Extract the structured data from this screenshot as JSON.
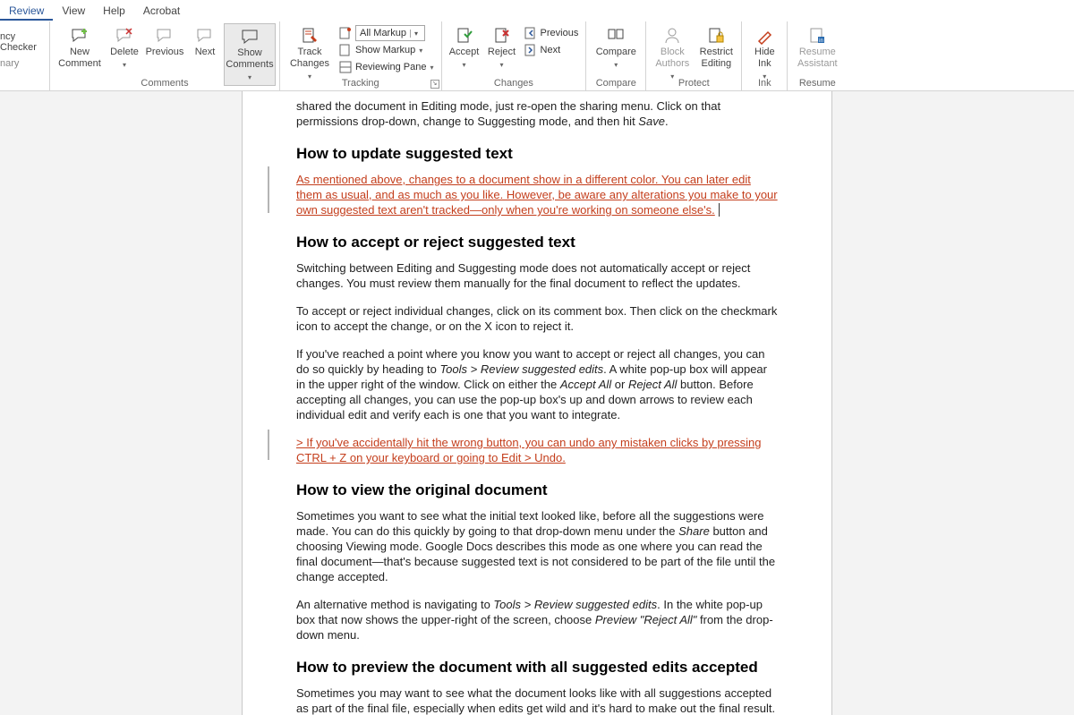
{
  "menu": {
    "review": "Review",
    "view": "View",
    "help": "Help",
    "acrobat": "Acrobat"
  },
  "ribbon": {
    "accessibility": {
      "checker_cut": "ncy Checker",
      "pane_cut": "nary"
    },
    "comments": {
      "new": "New Comment",
      "delete": "Delete",
      "previous": "Previous",
      "next": "Next",
      "show": "Show Comments",
      "group": "Comments"
    },
    "tracking": {
      "track_changes": "Track Changes",
      "all_markup": "All Markup",
      "show_markup": "Show Markup",
      "reviewing_pane": "Reviewing Pane",
      "group": "Tracking"
    },
    "changes": {
      "accept": "Accept",
      "reject": "Reject",
      "previous": "Previous",
      "next": "Next",
      "group": "Changes"
    },
    "compare": {
      "compare": "Compare",
      "group": "Compare"
    },
    "protect": {
      "block_authors": "Block Authors",
      "restrict_editing": "Restrict Editing",
      "group": "Protect"
    },
    "ink": {
      "hide_ink": "Hide Ink",
      "group": "Ink"
    },
    "resume": {
      "resume_assistant": "Resume Assistant",
      "group": "Resume"
    }
  },
  "doc": {
    "p_top_1": "shared the document in Editing mode, just re-open the sharing menu. Click on that permissions drop-down, change to Suggesting mode, and then hit ",
    "p_top_save": "Save",
    "p_top_period": ".",
    "h_update": "How to update suggested text",
    "p_update_tracked": "As mentioned above, changes to a document show in a different color. You can later edit them as usual, and as much as you like. However, be aware any alterations you make to your own suggested text aren't tracked—only when you're working on someone else's.",
    "h_accept": "How to accept or reject suggested text",
    "p_accept_1": "Switching between Editing and Suggesting mode does not automatically accept or reject changes. You must review them manually for the final document to reflect the updates.",
    "p_accept_2": "To accept or reject individual changes, click on its comment box. Then click on the checkmark icon to accept the change, or on the X icon to reject it.",
    "p_accept_3a": "If you've reached a point where you know you want to accept or reject all changes, you can do so quickly by heading to ",
    "p_accept_3_tools": "Tools > Review suggested edits",
    "p_accept_3b": ". A white pop-up box will appear in the upper right of the window. Click on either the ",
    "p_accept_3_acceptall": "Accept All",
    "p_accept_3_or": " or ",
    "p_accept_3_rejectall": "Reject All",
    "p_accept_3c": " button. Before accepting all changes, you can use the pop-up box's up and down arrows to review each individual edit and verify each is one that you want to integrate.",
    "p_accept_tracked": "> If you've accidentally hit the wrong button, you can undo any mistaken clicks by pressing CTRL + Z on your keyboard or going to Edit > Undo.",
    "h_view": "How to view the original document",
    "p_view_1a": "Sometimes you want to see what the initial text looked like, before all the suggestions were made. You can do this quickly by going to that drop-down menu under the ",
    "p_view_1_share": "Share",
    "p_view_1b": " button and choosing Viewing mode. Google Docs describes this mode as one where you can read the final document—that's because suggested text is not considered to be part of the file until the change accepted.",
    "p_view_2a": "An alternative method is navigating to ",
    "p_view_2_tools": "Tools > Review suggested edits",
    "p_view_2b": ". In the white pop-up box that now shows the upper-right of the screen, choose ",
    "p_view_2_preview": "Preview \"Reject All\"",
    "p_view_2c": " from the drop-down menu.",
    "h_preview": "How to preview the document with all suggested edits accepted",
    "p_preview_1": "Sometimes you may want to see what the document looks like with all suggestions accepted as part of the final file, especially when edits get wild and it's hard to make out the final result."
  }
}
